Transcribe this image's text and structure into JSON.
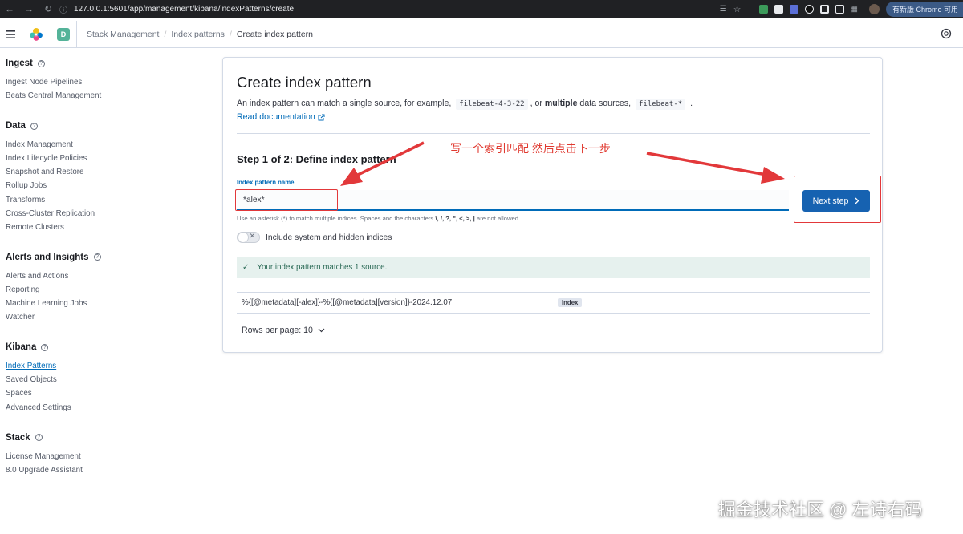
{
  "browser": {
    "url": "127.0.0.1:5601/app/management/kibana/indexPatterns/create",
    "update_label": "有新版 Chrome 可用"
  },
  "header": {
    "space_initial": "D",
    "breadcrumbs": [
      "Stack Management",
      "Index patterns",
      "Create index pattern"
    ]
  },
  "sidebar": {
    "sections": [
      {
        "title": "Ingest",
        "items": [
          "Ingest Node Pipelines",
          "Beats Central Management"
        ]
      },
      {
        "title": "Data",
        "items": [
          "Index Management",
          "Index Lifecycle Policies",
          "Snapshot and Restore",
          "Rollup Jobs",
          "Transforms",
          "Cross-Cluster Replication",
          "Remote Clusters"
        ]
      },
      {
        "title": "Alerts and Insights",
        "items": [
          "Alerts and Actions",
          "Reporting",
          "Machine Learning Jobs",
          "Watcher"
        ]
      },
      {
        "title": "Kibana",
        "items": [
          "Index Patterns",
          "Saved Objects",
          "Spaces",
          "Advanced Settings"
        ]
      },
      {
        "title": "Stack",
        "items": [
          "License Management",
          "8.0 Upgrade Assistant"
        ]
      }
    ],
    "active_item": "Index Patterns"
  },
  "panel": {
    "title": "Create index pattern",
    "desc_prefix": "An index pattern can match a single source, for example,",
    "example_single": "filebeat-4-3-22",
    "desc_mid": ", or",
    "desc_bold": "multiple",
    "desc_mid2": "data sources,",
    "example_multi": "filebeat-*",
    "desc_suffix": ".",
    "doc_link": "Read documentation",
    "step_title": "Step 1 of 2: Define index pattern",
    "field_label": "Index pattern name",
    "field_value": "*alex*",
    "help_prefix": "Use an asterisk (*) to match multiple indices. Spaces and the characters",
    "help_chars": "\\, /, ?, \", <, >, |",
    "help_suffix": "are not allowed.",
    "toggle_label": "Include system and hidden indices",
    "next_label": "Next step",
    "callout": "Your index pattern matches 1 source.",
    "result_name": "%{[@metadata][-alex]}-%{[@metadata][version]}-2024.12.07",
    "result_type": "Index",
    "rows_per_page": "Rows per page: 10"
  },
  "annotation": {
    "text": "写一个索引匹配 然后点击下一步",
    "color": "#e2383a"
  },
  "watermark": "掘金技术社区 @ 左诗右码"
}
